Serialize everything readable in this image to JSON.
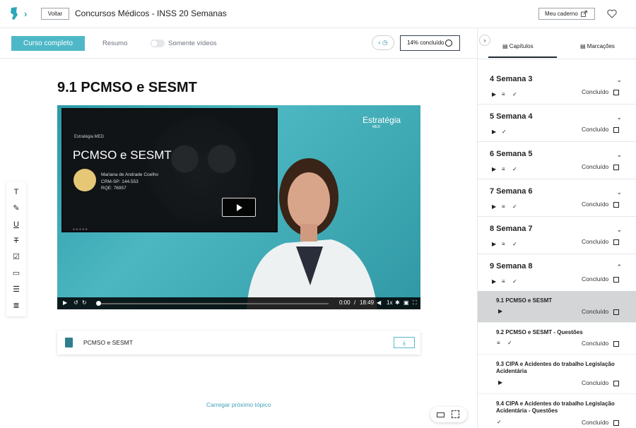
{
  "header": {
    "back_label": "Voltar",
    "course_title": "Concursos Médicos - INSS 20 Semanas",
    "notebook_label": "Meu caderno"
  },
  "toolbar": {
    "full_course_label": "Curso completo",
    "summary_label": "Resumo",
    "videos_only_label": "Somente vídeos",
    "progress_label": "14% concluído"
  },
  "lesson": {
    "title": "9.1 PCMSO e SESMT",
    "video": {
      "brand": "Estratégia MED",
      "logo_text": "Estratégia",
      "logo_sub": "MED",
      "slide_title": "PCMSO e SESMT",
      "instructor_name": "Mariana de Andrade Coelho",
      "crm": "CRM-SP: 144.553",
      "rqe": "RQE: 76957",
      "current_time": "0:00",
      "time_separator": "/",
      "duration": "18:49",
      "speed": "1x",
      "progress": 0
    },
    "material_label": "PCMSO e SESMT",
    "load_next_label": "Carregar próximo tópico"
  },
  "sidebar": {
    "tabs": [
      {
        "label": "Capítulos"
      },
      {
        "label": "Marcações"
      }
    ],
    "done_label": "Concluído",
    "weeks": [
      {
        "title": "4 Semana 3"
      },
      {
        "title": "5 Semana 4"
      },
      {
        "title": "6 Semana 5"
      },
      {
        "title": "7 Semana 6"
      },
      {
        "title": "8 Semana 7"
      },
      {
        "title": "9 Semana 8"
      }
    ],
    "lessons": [
      {
        "title": "9.1 PCMSO e SESMT"
      },
      {
        "title": "9.2 PCMSO e SESMT - Questões"
      },
      {
        "title": "9.3 CIPA e Acidentes do trabalho Legislação Acidentária"
      },
      {
        "title": "9.4 CIPA e Acidentes do trabalho Legislação Acidentária - Questões"
      }
    ]
  },
  "colors": {
    "accent": "#4fb8c8",
    "video_bg": "#3aa9b5",
    "active_row": "#d3d5d6"
  }
}
